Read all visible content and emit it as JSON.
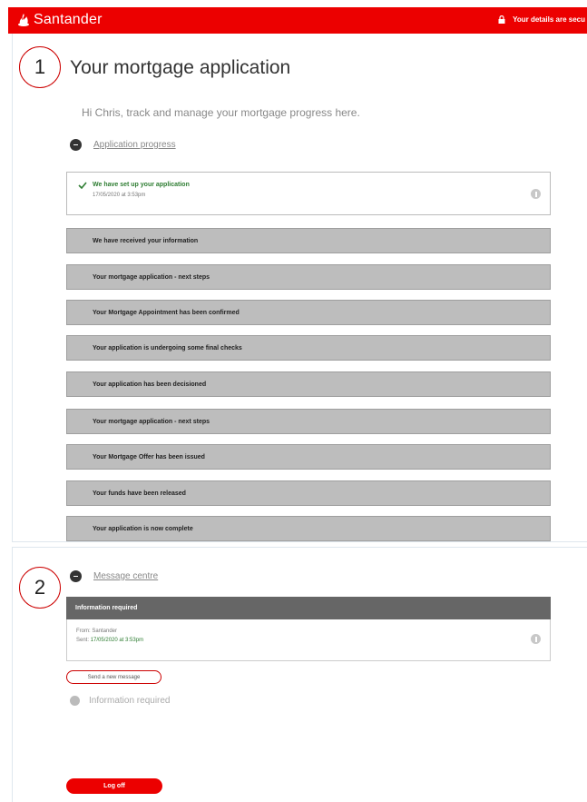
{
  "brand": {
    "name": "Santander",
    "logo_icon": "flame-icon",
    "color": "#ec0000"
  },
  "header": {
    "secure_text": "Your details are secu",
    "secure_icon": "lock-icon"
  },
  "annotations": [
    "1",
    "2"
  ],
  "main": {
    "title": "Your mortgage application",
    "subtitle": "Hi Chris, track and manage your mortgage progress here."
  },
  "progress": {
    "section_label": "Application progress",
    "current": {
      "title": "We have set up your application",
      "date": "17/05/2020 at 3:53pm"
    },
    "steps": [
      "We have received your information",
      "Your mortgage application - next steps",
      "Your Mortgage Appointment has been confirmed",
      "Your application is undergoing some final checks",
      "Your application has been decisioned",
      "Your mortgage application - next steps",
      "Your Mortgage Offer has been issued",
      "Your funds have been released",
      "Your application is now complete"
    ]
  },
  "messages": {
    "section_label": "Message centre",
    "header": "Information required",
    "from": "From: Santander",
    "sent_prefix": "Sent: ",
    "sent_time": "17/05/2020 at 3:53pm",
    "new_message_button": "Send a new message",
    "info_required_label": "Information required"
  },
  "logoff_button": "Log off"
}
